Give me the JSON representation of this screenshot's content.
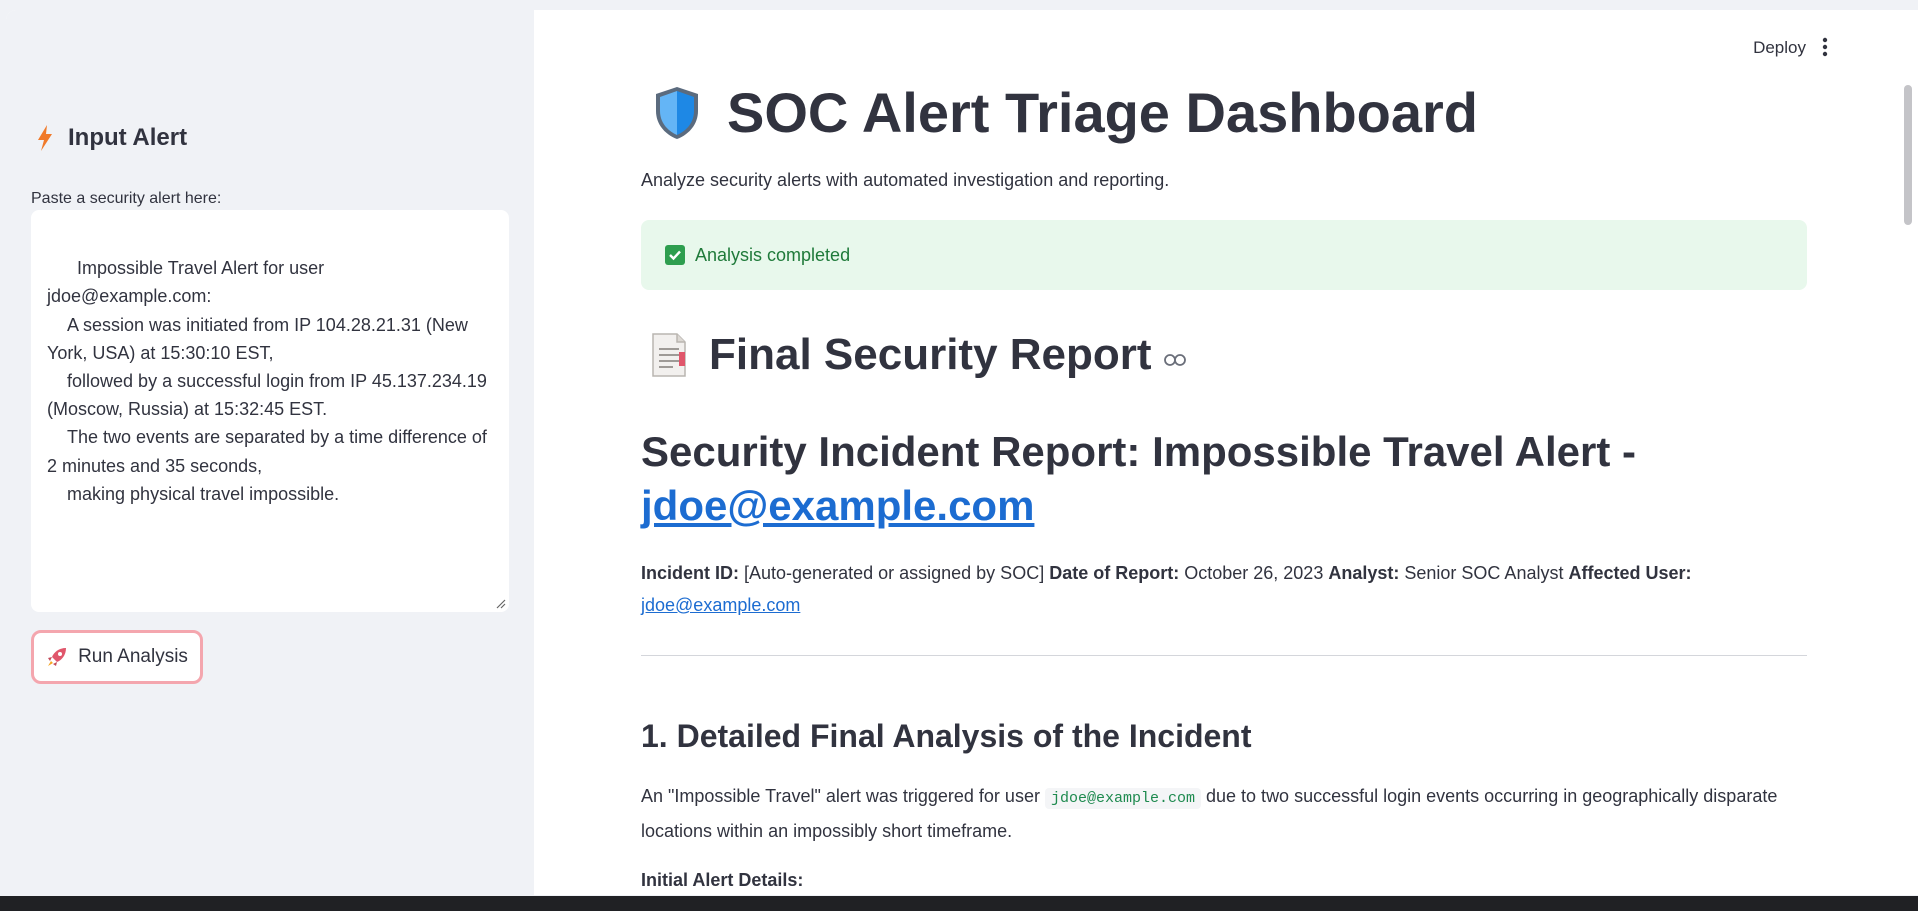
{
  "sidebar": {
    "header": "Input Alert",
    "label": "Paste a security alert here:",
    "alert_text": "Impossible Travel Alert for user jdoe@example.com:\n    A session was initiated from IP 104.28.21.31 (New York, USA) at 15:30:10 EST,\n    followed by a successful login from IP 45.137.234.19 (Moscow, Russia) at 15:32:45 EST.\n    The two events are separated by a time difference of 2 minutes and 35 seconds,\n    making physical travel impossible.",
    "run_button": "Run Analysis"
  },
  "toolbar": {
    "deploy": "Deploy"
  },
  "main": {
    "title": "SOC Alert Triage Dashboard",
    "subtitle": "Analyze security alerts with automated investigation and reporting.",
    "status": "Analysis completed",
    "report_title": "Final Security Report",
    "incident_title_prefix": "Security Incident Report: Impossible Travel Alert -",
    "incident_title_link": "jdoe@example.com",
    "meta": {
      "incident_id_label": "Incident ID:",
      "incident_id_value": "[Auto-generated or assigned by SOC]",
      "date_label": "Date of Report:",
      "date_value": "October 26, 2023",
      "analyst_label": "Analyst:",
      "analyst_value": "Senior SOC Analyst",
      "user_label": "Affected User:",
      "user_value": "jdoe@example.com"
    },
    "section1_title": "1. Detailed Final Analysis of the Incident",
    "section1_text_a": "An \"Impossible Travel\" alert was triggered for user",
    "section1_code": "jdoe@example.com",
    "section1_text_b": "due to two successful login events occurring in geographically disparate locations within an impossibly short timeframe.",
    "alert_details_label": "Initial Alert Details:"
  },
  "colors": {
    "accent": "#ff4b4b",
    "link": "#1c6cd1",
    "success_bg": "#e8f8ec",
    "success_text": "#1f7a3a"
  }
}
